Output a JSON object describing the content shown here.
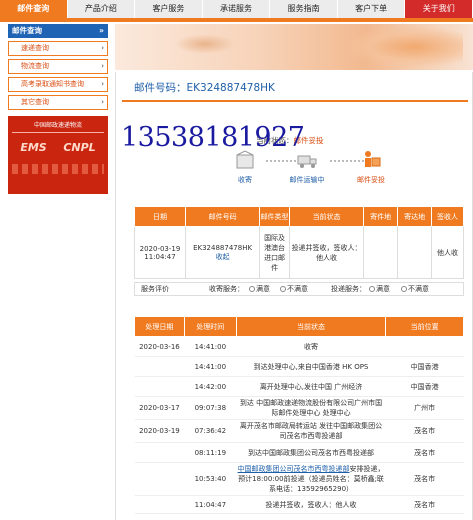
{
  "topnav": {
    "tabs": [
      {
        "label": "邮件查询",
        "active": true
      },
      {
        "label": "产品介绍",
        "active": false
      },
      {
        "label": "客户服务",
        "active": false
      },
      {
        "label": "承诺服务",
        "active": false
      },
      {
        "label": "服务指南",
        "active": false
      },
      {
        "label": "客户下单",
        "active": false
      },
      {
        "label": "关于我们",
        "active": false
      }
    ]
  },
  "sidebar": {
    "title": "邮件查询",
    "title_icon": "chevron-double-up-icon",
    "items": [
      {
        "label": "速递查询"
      },
      {
        "label": "物流查询"
      },
      {
        "label": "高考录取通知书查询"
      },
      {
        "label": "其它查询"
      }
    ],
    "logo": {
      "org": "中国邮政速递物流",
      "brand_left": "EMS",
      "brand_right": "CNPL"
    }
  },
  "main": {
    "title": "邮件号码：EK324887478HK",
    "phone_overlay": "13538181927",
    "status": {
      "prefix": "当前状态：",
      "value": "邮件妥投",
      "steps": [
        {
          "label": "收寄",
          "icon": "box-icon"
        },
        {
          "label": "邮件运输中",
          "icon": "truck-icon"
        },
        {
          "label": "邮件妥投",
          "icon": "delivery-person-icon"
        }
      ]
    },
    "summary_table": {
      "headers": [
        "日期",
        "邮件号码",
        "邮件类型",
        "当前状态",
        "寄件地",
        "寄达地",
        "签收人"
      ],
      "row": {
        "date": "2020-03-19 11:04:47",
        "mail_no": "EK324887478HK",
        "mail_link": "收起",
        "type": "国际及港澳台进口邮件",
        "status": "投递并签收，签收人：他人收",
        "from": "",
        "to": "",
        "signer": "他人收"
      }
    },
    "evaluation": {
      "label": "服务评价",
      "collect_label": "收寄服务：",
      "deliver_label": "投递服务：",
      "options": [
        "满意",
        "不满意"
      ]
    },
    "tracking_table": {
      "headers": [
        "处理日期",
        "处理时间",
        "当前状态",
        "当前位置"
      ],
      "rows": [
        {
          "date": "2020-03-16",
          "time": "14:41:00",
          "status": "收寄",
          "location": ""
        },
        {
          "date": "",
          "time": "14:41:00",
          "status": "到达处理中心,来自中国香港 HK OPS",
          "location": "中国香港"
        },
        {
          "date": "",
          "time": "14:42:00",
          "status": "离开处理中心,发往中国 广州经济",
          "location": "中国香港"
        },
        {
          "date": "2020-03-17",
          "time": "09:07:38",
          "status": "到达 中国邮政速递物流股份有限公司广州市国际邮件处理中心 处理中心",
          "location": "广州市"
        },
        {
          "date": "2020-03-19",
          "time": "07:36:42",
          "status": "离开茂名市邮政局转运站 发往中国邮政集团公司茂名市西粤投递部",
          "location": "茂名市"
        },
        {
          "date": "",
          "time": "08:11:19",
          "status": "到达中国邮政集团公司茂名市西粤投递部",
          "location": "茂名市"
        },
        {
          "date": "",
          "time": "10:53:40",
          "status_link": "中国邮政集团公司茂名市西粤投递部",
          "status": "安排投递，预计18:00:00前投递（投递员姓名：莫桥鑫;联系电话：13592965290）",
          "location": "茂名市"
        },
        {
          "date": "",
          "time": "11:04:47",
          "status": "投递并签收，签收人：他人收",
          "location": "茂名市"
        }
      ]
    }
  }
}
